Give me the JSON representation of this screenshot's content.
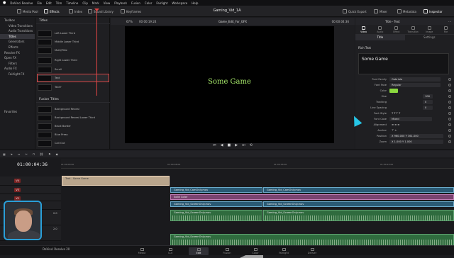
{
  "menubar": {
    "apple": "",
    "items": [
      "DaVinci Resolve",
      "File",
      "Edit",
      "Trim",
      "Timeline",
      "Clip",
      "Mark",
      "View",
      "Playback",
      "Fusion",
      "Color",
      "Fairlight",
      "Workspace",
      "Help"
    ]
  },
  "toolbar": {
    "left": [
      "Media Pool",
      "Effects",
      "Index",
      "Sound Library",
      "Keyframes"
    ],
    "active": "Effects",
    "project_title": "Gaming_Vid_1A",
    "right": [
      "Quick Export",
      "Mixer",
      "Metadata",
      "Inspector"
    ]
  },
  "effects": {
    "tree": [
      {
        "label": "Toolbox",
        "sub": false
      },
      {
        "label": "Video Transitions",
        "sub": true
      },
      {
        "label": "Audio Transitions",
        "sub": true
      },
      {
        "label": "Titles",
        "sub": false,
        "selected": true
      },
      {
        "label": "Generators",
        "sub": true
      },
      {
        "label": "Effects",
        "sub": true
      },
      {
        "label": "Resolve FX",
        "sub": false
      },
      {
        "label": "Open FX",
        "sub": false
      },
      {
        "label": "Filters",
        "sub": true
      },
      {
        "label": "Audio FX",
        "sub": false
      },
      {
        "label": "Fairlight FX",
        "sub": true
      },
      {
        "label": "Favorites",
        "sub": false
      }
    ],
    "titles_header": "Titles",
    "titles": [
      "Left Lower Third",
      "Middle Lower Third",
      "Multi/Title",
      "Right Lower Third",
      "Scroll",
      "Text",
      "Text+"
    ],
    "selected_title": "Text",
    "fusion_header": "Fusion Titles",
    "fusion_titles": [
      "Background Reveal",
      "Background Reveal Lower Third",
      "Black Border",
      "Blue Press",
      "Call Out"
    ]
  },
  "viewer": {
    "zoom": "67%",
    "timecode_left": "00:00:19:24",
    "timeline_name": "Game_Edit_For_GFX",
    "timecode_right": "00:00:04:36",
    "canvas_text": "Some Game",
    "transport": [
      "⏮",
      "◀",
      "■",
      "▶",
      "⏭",
      "⟲"
    ]
  },
  "inspector": {
    "title": "Title - Text",
    "tabs": [
      "Video",
      "Audio",
      "Effect",
      "Transition",
      "Image",
      "File"
    ],
    "active_tab": "Video",
    "subtabs": [
      "Title",
      "Settings"
    ],
    "active_subtab": "Title",
    "rich_text_label": "Rich Text",
    "rich_text": "Some Game",
    "props": [
      {
        "label": "Font Family",
        "value": "Gabriola"
      },
      {
        "label": "Font Face",
        "value": "Regular"
      },
      {
        "label": "Color",
        "value": ""
      },
      {
        "label": "Size",
        "value": "106"
      },
      {
        "label": "Tracking",
        "value": "0"
      },
      {
        "label": "Line Spacing",
        "value": "0"
      },
      {
        "label": "Font Style",
        "value": "T T T T"
      },
      {
        "label": "Font Case",
        "value": "Mixed"
      },
      {
        "label": "Alignment",
        "value": "≡ ≡ ≡"
      },
      {
        "label": "Anchor",
        "value": "⊤ ⊥"
      },
      {
        "label": "Position",
        "value": "X  960.000    Y  361.000"
      },
      {
        "label": "Zoom",
        "value": "X  1.000    Y  1.000"
      }
    ],
    "text_color": "#8bd83f"
  },
  "timeline": {
    "timecode": "01:00:04:36",
    "ruler": [
      "01:00:00:00",
      "01:00:08:00",
      "01:00:16:00",
      "01:00:24:00",
      "01:00:32:00",
      "01:00:40:00"
    ],
    "tracks": [
      {
        "id": "V4",
        "type": "v"
      },
      {
        "id": "V3",
        "type": "v"
      },
      {
        "id": "V2",
        "type": "v"
      },
      {
        "id": "V1",
        "type": "v"
      },
      {
        "id": "A1",
        "type": "a",
        "level": "2.0"
      },
      {
        "id": "A2",
        "type": "a",
        "level": "2.0"
      }
    ],
    "clips": {
      "title": "Text - Some Game",
      "v3a": "Gaming_Vid_CamOnly.mov",
      "v3b": "Gaming_Vid_CamOnly.mov",
      "v2": "Solid Color",
      "v1a": "Gaming_Vid_ScreenOnly.mov",
      "v1b": "Gaming_Vid_ScreenOnly.mov",
      "a1a": "Gaming_Vid_ScreenOnly.mov",
      "a1b": "Gaming_Vid_ScreenOnly.mov",
      "a2": "Gaming_Vid_ScreenOnly.mov",
      "crossfade": "Cross Fade"
    }
  },
  "pages": [
    "Media",
    "Cut",
    "Edit",
    "Fusion",
    "Color",
    "Fairlight",
    "Deliver"
  ],
  "active_page": "Edit",
  "app_label": "DaVinci Resolve 20"
}
